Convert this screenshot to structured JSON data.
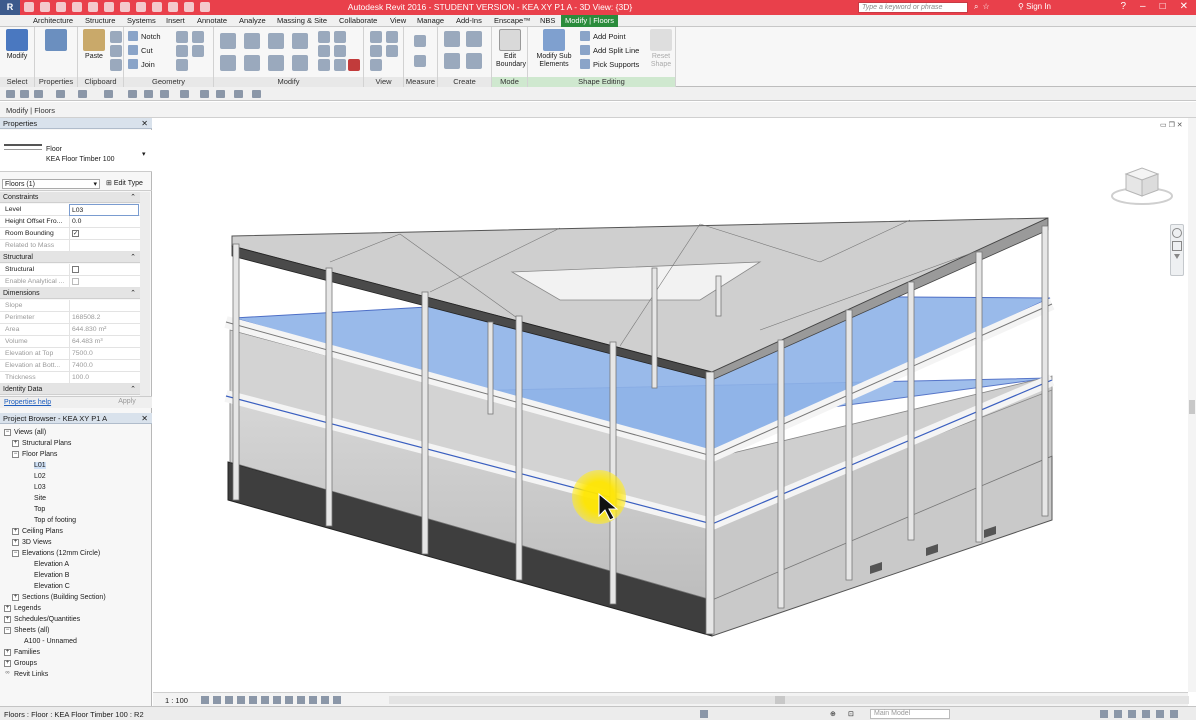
{
  "app": {
    "window_title": "Autodesk Revit 2016 - STUDENT VERSION -    KEA XY P1 A - 3D View: {3D}",
    "search_placeholder": "Type a keyword or phrase",
    "signin_label": "Sign In"
  },
  "ribbon_tabs": [
    "Architecture",
    "Structure",
    "Systems",
    "Insert",
    "Annotate",
    "Analyze",
    "Massing & Site",
    "Collaborate",
    "View",
    "Manage",
    "Add-Ins",
    "Enscape™",
    "NBS",
    "Modify | Floors"
  ],
  "ribbon": {
    "select": {
      "button": "Modify",
      "label": "Select"
    },
    "properties": {
      "label": "Properties"
    },
    "clipboard": {
      "paste": "Paste",
      "label": "Clipboard"
    },
    "geometry": {
      "notch": "Notch",
      "cut": "Cut",
      "join": "Join",
      "label": "Geometry"
    },
    "modify": {
      "label": "Modify"
    },
    "view": {
      "label": "View"
    },
    "measure": {
      "label": "Measure"
    },
    "create": {
      "label": "Create"
    },
    "mode": {
      "button": "Edit Boundary",
      "label": "Mode"
    },
    "shape_editing": {
      "modify_sub": "Modify Sub Elements",
      "add_point": "Add Point",
      "add_split_line": "Add Split Line",
      "pick_supports": "Pick Supports",
      "reset_shape": "Reset Shape",
      "label": "Shape Editing"
    }
  },
  "context_bar": {
    "label": "Modify | Floors"
  },
  "properties_panel": {
    "header": "Properties",
    "type_category": "Floor",
    "type_name": "KEA Floor Timber 100",
    "instance_filter": "Floors (1)",
    "edit_type": "Edit Type",
    "sections": {
      "constraints": "Constraints",
      "structural": "Structural",
      "dimensions": "Dimensions",
      "identity": "Identity Data"
    },
    "constraints": [
      {
        "name": "Level",
        "value": "L03"
      },
      {
        "name": "Height Offset Fro...",
        "value": "0.0"
      },
      {
        "name": "Room Bounding",
        "value": "✓"
      },
      {
        "name": "Related to Mass",
        "value": ""
      }
    ],
    "structural": [
      {
        "name": "Structural",
        "value": ""
      },
      {
        "name": "Enable Analytical ...",
        "value": ""
      }
    ],
    "dimensions": [
      {
        "name": "Slope",
        "value": ""
      },
      {
        "name": "Perimeter",
        "value": "168508.2"
      },
      {
        "name": "Area",
        "value": "644.830 m²"
      },
      {
        "name": "Volume",
        "value": "64.483 m³"
      },
      {
        "name": "Elevation at Top",
        "value": "7500.0"
      },
      {
        "name": "Elevation at Bott...",
        "value": "7400.0"
      },
      {
        "name": "Thickness",
        "value": "100.0"
      }
    ],
    "help_link": "Properties help",
    "apply": "Apply"
  },
  "project_browser": {
    "header": "Project Browser - KEA XY P1 A",
    "tree": [
      {
        "label": "Views (all)",
        "toggle": "−"
      },
      {
        "label": "Structural Plans",
        "toggle": "+"
      },
      {
        "label": "Floor Plans",
        "toggle": "−"
      },
      {
        "label": "L01",
        "toggle": ""
      },
      {
        "label": "L02",
        "toggle": ""
      },
      {
        "label": "L03",
        "toggle": ""
      },
      {
        "label": "Site",
        "toggle": ""
      },
      {
        "label": "Top",
        "toggle": ""
      },
      {
        "label": "Top of footing",
        "toggle": ""
      },
      {
        "label": "Ceiling Plans",
        "toggle": "+"
      },
      {
        "label": "3D Views",
        "toggle": "+"
      },
      {
        "label": "Elevations (12mm Circle)",
        "toggle": "−"
      },
      {
        "label": "Elevation A",
        "toggle": ""
      },
      {
        "label": "Elevation B",
        "toggle": ""
      },
      {
        "label": "Elevation C",
        "toggle": ""
      },
      {
        "label": "Sections (Building Section)",
        "toggle": "+"
      },
      {
        "label": "Legends",
        "toggle": "+"
      },
      {
        "label": "Schedules/Quantities",
        "toggle": "+"
      },
      {
        "label": "Sheets (all)",
        "toggle": "−"
      },
      {
        "label": "A100 - Unnamed",
        "toggle": ""
      },
      {
        "label": "Families",
        "toggle": "+"
      },
      {
        "label": "Groups",
        "toggle": "+"
      },
      {
        "label": "Revit Links",
        "toggle": "∞"
      }
    ]
  },
  "view_bar": {
    "scale": "1 : 100"
  },
  "status_bar": {
    "text": "Floors : Floor : KEA Floor Timber 100 : R2",
    "workset": "Main Model"
  },
  "colors": {
    "title_bar": "#e9404b",
    "context_tab": "#2a8c3c",
    "selected_floor": "#8fb3e8",
    "cursor_highlight": "#ffe600"
  }
}
